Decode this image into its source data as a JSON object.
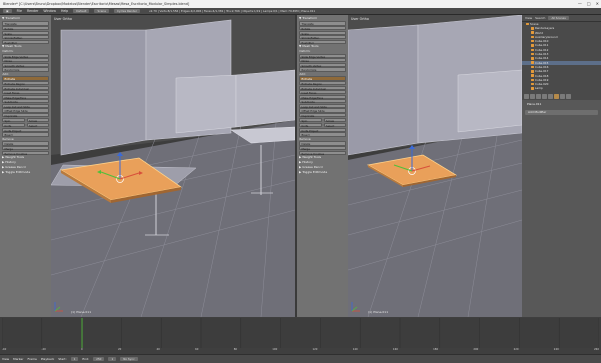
{
  "window": {
    "title": "Blender* [C:\\Users\\Bruno\\Dropbox\\Modelos\\Blender\\Escritorio\\Mesas\\Mesa_Escritorio_Modular_Simples.blend]",
    "controls": [
      "—",
      "□",
      "✕"
    ]
  },
  "topbar": {
    "menus": [
      "File",
      "Render",
      "Window",
      "Help"
    ],
    "layout": "Default",
    "scene": "Scene",
    "engine": "Cycles Render",
    "stats": "v2.79 | Verts:8/1,556 | Edges:4/2,906 | Faces:4/1,381 | Tris:2,766 | Objects:1/19 | Lamps:0/1 | Mem:79.65M | Plane.011"
  },
  "left_tools": {
    "sections": [
      {
        "type": "hdr",
        "text": "▼ Transform"
      },
      {
        "type": "btn",
        "text": "Translate"
      },
      {
        "type": "btn",
        "text": "Rotate"
      },
      {
        "type": "btn",
        "text": "Scale"
      },
      {
        "type": "btn",
        "text": "Shrink/Fatten"
      },
      {
        "type": "btn",
        "text": "Push/Pull"
      },
      {
        "type": "hdr",
        "text": "▼ Mesh Tools"
      },
      {
        "type": "lbl",
        "text": "Deform:"
      },
      {
        "type": "btn",
        "text": "Slide Edge  Vertex"
      },
      {
        "type": "btn",
        "text": "Noise"
      },
      {
        "type": "btn",
        "text": "Smooth Vertex"
      },
      {
        "type": "btn",
        "text": "Randomize"
      },
      {
        "type": "lbl",
        "text": "Add:"
      },
      {
        "type": "btn",
        "text": "Extrude",
        "sel": true
      },
      {
        "type": "btn",
        "text": "Extrude Region"
      },
      {
        "type": "btn",
        "text": "Extrude Individual"
      },
      {
        "type": "btn",
        "text": "Inset Faces"
      },
      {
        "type": "btn",
        "text": "Make Edge/Face"
      },
      {
        "type": "btn",
        "text": "Subdivide"
      },
      {
        "type": "btn",
        "text": "Loop Cut and Slide"
      },
      {
        "type": "btn",
        "text": "Offset Edge Slide"
      },
      {
        "type": "btn",
        "text": "Duplicate"
      },
      {
        "type": "pair",
        "a": "Spin",
        "b": "Screw"
      },
      {
        "type": "pair",
        "a": "Knife",
        "b": "Select"
      },
      {
        "type": "btn",
        "text": "Knife Project"
      },
      {
        "type": "btn",
        "text": "Bisect"
      },
      {
        "type": "lbl",
        "text": "Remove:"
      },
      {
        "type": "btn",
        "text": "Delete"
      },
      {
        "type": "btn",
        "text": "Merge"
      },
      {
        "type": "btn",
        "text": "Remove Doubles"
      },
      {
        "type": "hdr",
        "text": "▶ Weight Tools"
      },
      {
        "type": "hdr",
        "text": "▶ History"
      },
      {
        "type": "hdr",
        "text": "▶ Grease Pencil"
      },
      {
        "type": "hdr",
        "text": "▶ Toggle Editmode"
      }
    ]
  },
  "viewport_left": {
    "title": "User Ortho",
    "object": "(1) Plane.011"
  },
  "viewport_right": {
    "title": "User Ortho",
    "object": "(1) Plane.011"
  },
  "header3d": {
    "menus": [
      "View",
      "Select",
      "Add",
      "Mesh"
    ],
    "mode": "Edit Mode",
    "pivot": "Global",
    "snap": "Closest"
  },
  "outliner": {
    "menus": [
      "View",
      "Search"
    ],
    "filter": "All Scenes",
    "rows": [
      {
        "text": "Scene",
        "indent": false,
        "sel": false
      },
      {
        "text": "RenderLayers",
        "indent": true,
        "sel": false
      },
      {
        "text": "World",
        "indent": true,
        "sel": false
      },
      {
        "text": "AuxiliaryGround",
        "indent": true,
        "sel": false
      },
      {
        "text": "Cube.010",
        "indent": true,
        "sel": false
      },
      {
        "text": "Cube.011",
        "indent": true,
        "sel": false
      },
      {
        "text": "Cube.012",
        "indent": true,
        "sel": false
      },
      {
        "text": "Cube.013",
        "indent": true,
        "sel": false
      },
      {
        "text": "Cube.014",
        "indent": true,
        "sel": false
      },
      {
        "text": "Cube.015",
        "indent": true,
        "sel": true
      },
      {
        "text": "Cube.016",
        "indent": true,
        "sel": false
      },
      {
        "text": "Cube.017",
        "indent": true,
        "sel": false
      },
      {
        "text": "Cube.018",
        "indent": true,
        "sel": false
      },
      {
        "text": "Cube.019",
        "indent": true,
        "sel": false
      },
      {
        "text": "Cube.020",
        "indent": true,
        "sel": false
      },
      {
        "text": "Lamp",
        "indent": true,
        "sel": false
      }
    ]
  },
  "props": {
    "object_name": "Plane.011",
    "add_modifier": "Add Modifier"
  },
  "timeline": {
    "menus": [
      "View",
      "Marker",
      "Frame",
      "Playback"
    ],
    "start": "Start:",
    "start_val": "1",
    "end": "End:",
    "end_val": "250",
    "current": "1",
    "sync": "No Sync",
    "ticks": [
      "-40",
      "-20",
      "0",
      "20",
      "40",
      "60",
      "80",
      "100",
      "120",
      "140",
      "160",
      "180",
      "200",
      "220",
      "240",
      "260"
    ]
  }
}
